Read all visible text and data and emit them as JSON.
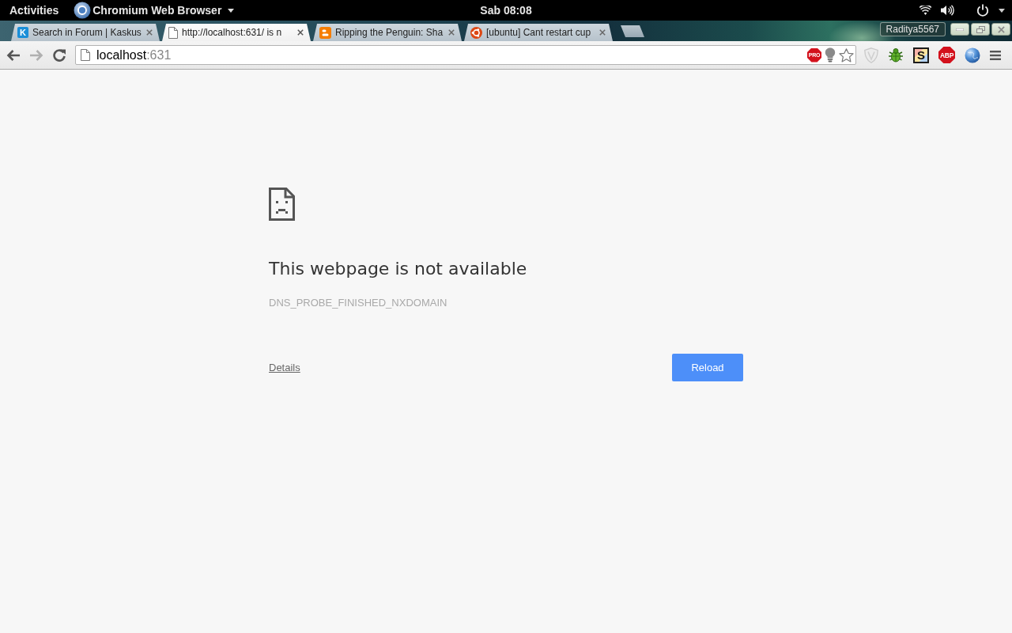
{
  "top_bar": {
    "activities": "Activities",
    "app_menu": "Chromium Web Browser",
    "clock": "Sab 08:08"
  },
  "tabs": [
    {
      "kind": "letter",
      "glyph": "K",
      "title": "Search in Forum | Kaskus",
      "selected": false
    },
    {
      "kind": "page",
      "title": "http://localhost:631/ is n",
      "selected": true
    },
    {
      "kind": "square",
      "title": "Ripping the Penguin: Sha",
      "selected": false
    },
    {
      "kind": "ring",
      "title": "[ubuntu] Cant restart cup",
      "selected": false
    }
  ],
  "profile": "Raditya5567",
  "navigation": {
    "back_disabled": false,
    "forward_disabled": true
  },
  "omnibox": {
    "host": "localhost",
    "port": ":631",
    "actions": [
      {
        "kind": "stop-sign",
        "label": "PRO"
      },
      {
        "kind": "bulb"
      },
      {
        "kind": "star"
      }
    ]
  },
  "extensions": [
    {
      "kind": "shield"
    },
    {
      "kind": "bug"
    },
    {
      "kind": "tile",
      "label": "S"
    },
    {
      "kind": "stop-sign",
      "label": "ABP"
    },
    {
      "kind": "globe"
    }
  ],
  "error": {
    "title": "This webpage is not available",
    "code": "DNS_PROBE_FINISHED_NXDOMAIN",
    "details_link": "Details",
    "reload_button": "Reload"
  }
}
